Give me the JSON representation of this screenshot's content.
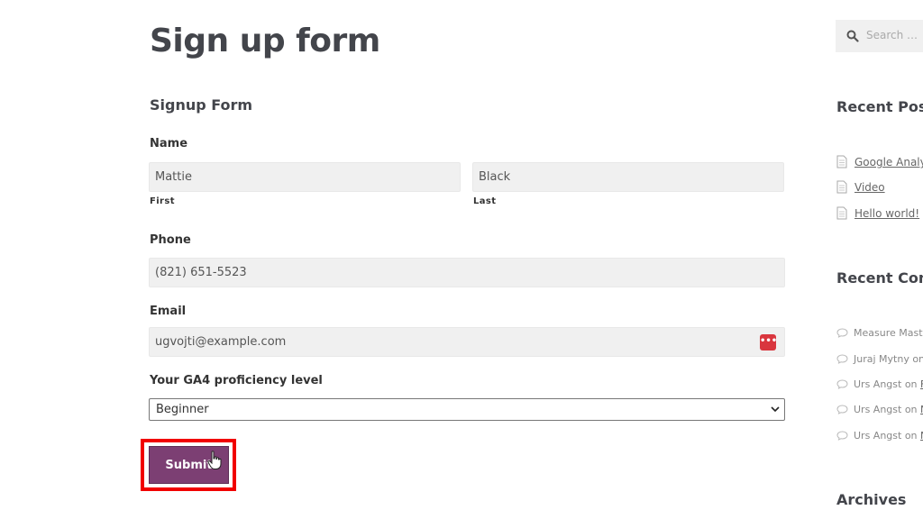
{
  "page": {
    "title": "Sign up form"
  },
  "form": {
    "heading": "Signup Form",
    "name": {
      "label": "Name",
      "first_value": "Mattie",
      "first_sublabel": "First",
      "last_value": "Black",
      "last_sublabel": "Last"
    },
    "phone": {
      "label": "Phone",
      "value": "(821) 651-5523"
    },
    "email": {
      "label": "Email",
      "value": "ugvojti@example.com",
      "icon_glyph": "•••"
    },
    "proficiency": {
      "label": "Your GA4 proficiency level",
      "selected": "Beginner"
    },
    "submit_label": "Submit"
  },
  "sidebar": {
    "search_placeholder": "Search …",
    "recent_posts": {
      "heading": "Recent Posts",
      "items": [
        "Google Analyti",
        "Video",
        "Hello world!"
      ]
    },
    "recent_comments": {
      "heading": "Recent Comm",
      "items": [
        {
          "author": "Measure Maste",
          "on": "",
          "link": ""
        },
        {
          "author": "Juraj Mytny",
          "on": " on",
          "link": ""
        },
        {
          "author": "Urs Angst",
          "on": " on ",
          "link": "Fi"
        },
        {
          "author": "Urs Angst",
          "on": " on ",
          "link": "Ni"
        },
        {
          "author": "Urs Angst",
          "on": " on ",
          "link": "Ni"
        }
      ]
    },
    "archives_heading": "Archives"
  },
  "colors": {
    "submit_bg": "#7c3f73",
    "highlight": "#f10000",
    "key_icon": "#d9363e"
  }
}
